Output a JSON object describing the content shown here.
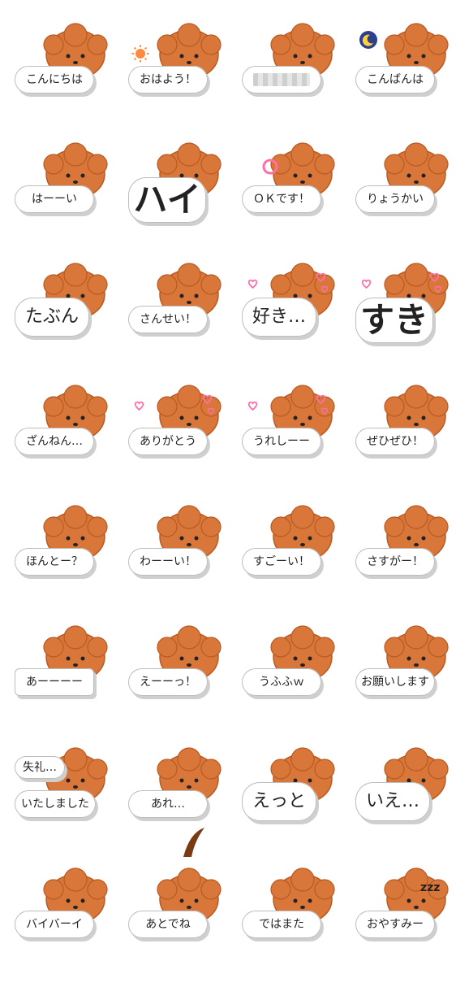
{
  "colors": {
    "fur": "#d9773a",
    "fur_dark": "#b85a22",
    "mouth": "#e86b7f",
    "bubble": "#ffffff",
    "shadow": "#cfcfcf",
    "text": "#222222",
    "heart": "#ff6fa8",
    "sun": "#ff8a3d",
    "moon_bg": "#2d3f8f",
    "moon": "#ffd23a"
  },
  "stickers": [
    {
      "text": "こんにちは",
      "size": "normal",
      "extra": "none"
    },
    {
      "text": "おはよう！",
      "size": "normal",
      "extra": "sun-icon"
    },
    {
      "text": "",
      "size": "normal",
      "extra": "redacted"
    },
    {
      "text": "こんばんは",
      "size": "normal",
      "extra": "moon-icon"
    },
    {
      "text": "はーーい",
      "size": "normal",
      "extra": "none"
    },
    {
      "text": "ハイ",
      "size": "huge",
      "extra": "none"
    },
    {
      "text": "ＯＫです！",
      "size": "normal",
      "extra": "ok-circle-icon"
    },
    {
      "text": "りょうかい",
      "size": "normal",
      "extra": "none"
    },
    {
      "text": "たぶん",
      "size": "large",
      "extra": "none"
    },
    {
      "text": "さんせい！",
      "size": "normal",
      "extra": "none"
    },
    {
      "text": "好き…",
      "size": "large",
      "extra": "hearts-icon"
    },
    {
      "text": "すき",
      "size": "huge",
      "extra": "hearts-icon"
    },
    {
      "text": "ざんねん…",
      "size": "normal",
      "extra": "none"
    },
    {
      "text": "ありがとう",
      "size": "normal",
      "extra": "hearts-icon"
    },
    {
      "text": "うれしーー",
      "size": "normal",
      "extra": "hearts-icon"
    },
    {
      "text": "ぜひぜひ！",
      "size": "normal",
      "extra": "none"
    },
    {
      "text": "ほんとー？",
      "size": "normal",
      "extra": "none"
    },
    {
      "text": "わーーい！",
      "size": "normal",
      "extra": "none"
    },
    {
      "text": "すごーい！",
      "size": "normal",
      "extra": "none"
    },
    {
      "text": "さすがー！",
      "size": "normal",
      "extra": "none"
    },
    {
      "text": "あーーーー",
      "size": "normal",
      "extra": "jagged"
    },
    {
      "text": "えーーっ！",
      "size": "normal",
      "extra": "none"
    },
    {
      "text": "うふふｗ",
      "size": "normal",
      "extra": "none"
    },
    {
      "text": "お願いします",
      "size": "normal",
      "extra": "none"
    },
    {
      "text": "失礼…",
      "text2": "いたしました",
      "size": "normal",
      "extra": "two-bubbles"
    },
    {
      "text": "あれ…",
      "size": "normal",
      "extra": "curl-icon"
    },
    {
      "text": "えっと",
      "size": "large",
      "extra": "none"
    },
    {
      "text": "いえ…",
      "size": "large",
      "extra": "none"
    },
    {
      "text": "バイバーイ",
      "size": "normal",
      "extra": "none"
    },
    {
      "text": "あとでね",
      "size": "normal",
      "extra": "none"
    },
    {
      "text": "ではまた",
      "size": "normal",
      "extra": "none"
    },
    {
      "text": "おやすみー",
      "size": "normal",
      "extra": "zzz-icon"
    }
  ]
}
